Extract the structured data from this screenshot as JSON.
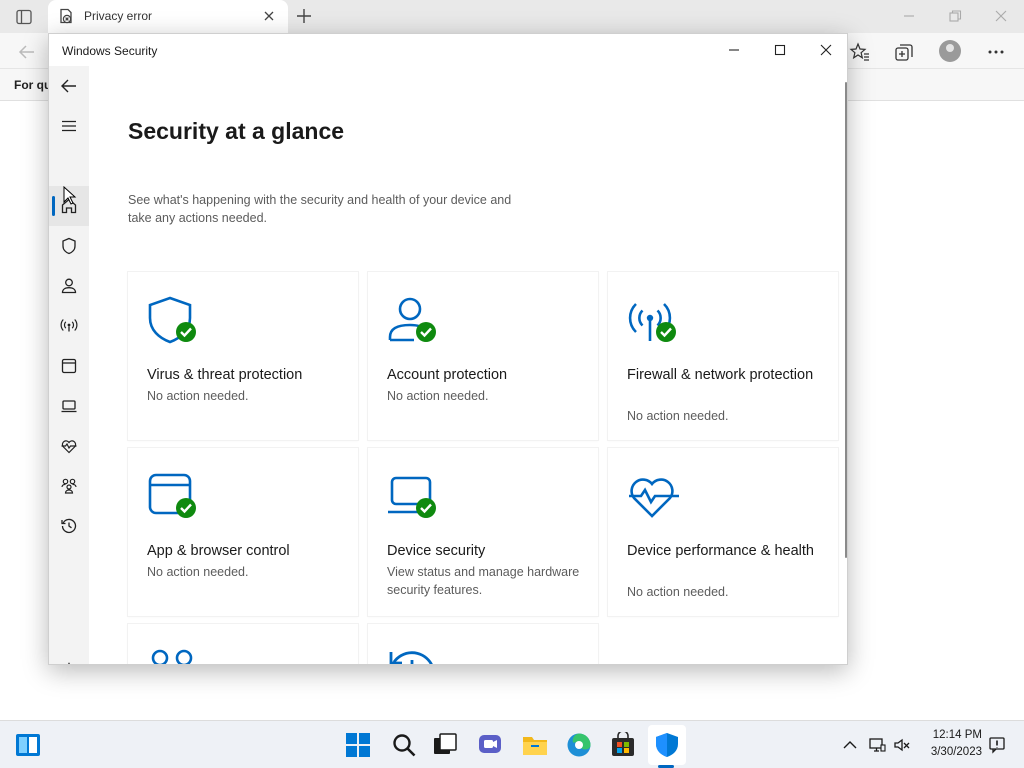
{
  "browser": {
    "tab_title": "Privacy error",
    "favorites_text": "For qu"
  },
  "window": {
    "title": "Windows Security"
  },
  "nav": {
    "items": [
      {
        "name": "back-icon"
      },
      {
        "name": "menu-icon"
      },
      {
        "name": "home-icon",
        "active": true
      },
      {
        "name": "shield-icon"
      },
      {
        "name": "person-icon"
      },
      {
        "name": "wireless-icon"
      },
      {
        "name": "app-browser-icon"
      },
      {
        "name": "laptop-icon"
      },
      {
        "name": "heartbeat-icon"
      },
      {
        "name": "family-icon"
      },
      {
        "name": "history-icon"
      },
      {
        "name": "settings-icon"
      }
    ]
  },
  "main": {
    "title": "Security at a glance",
    "description": "See what's happening with the security and health of your device and take any actions needed.",
    "tiles": [
      {
        "title": "Virus & threat protection",
        "status": "No action needed.",
        "icon": "shield-check-icon"
      },
      {
        "title": "Account protection",
        "status": "No action needed.",
        "icon": "account-check-icon"
      },
      {
        "title": "Firewall & network protection",
        "status": "No action needed.",
        "icon": "firewall-check-icon"
      },
      {
        "title": "App & browser control",
        "status": "No action needed.",
        "icon": "app-browser-check-icon"
      },
      {
        "title": "Device security",
        "status": "View status and manage hardware security features.",
        "icon": "device-check-icon"
      },
      {
        "title": "Device performance & health",
        "status": "No action needed.",
        "icon": "heart-icon"
      },
      {
        "title": "",
        "status": "",
        "icon": "family-options-icon"
      },
      {
        "title": "",
        "status": "",
        "icon": "protection-history-icon"
      }
    ]
  },
  "taskbar": {
    "time": "12:14 PM",
    "date": "3/30/2023"
  },
  "colors": {
    "accent": "#0067c0",
    "ok_green": "#0f8a0f",
    "nav_bg": "#f3f3f3"
  }
}
